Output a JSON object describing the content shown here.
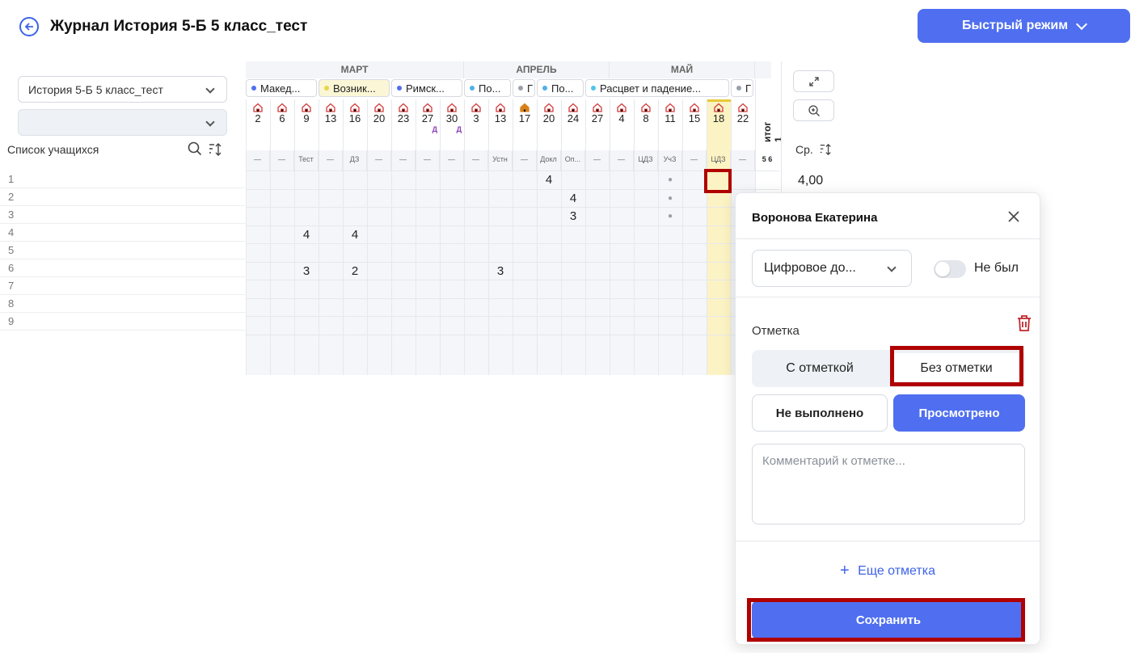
{
  "header": {
    "title": "Журнал История 5-Б 5 класс_тест",
    "mode_button": "Быстрый режим"
  },
  "left": {
    "group_select": "История 5-Б 5 класс_тест",
    "second_select": "",
    "students_label": "Список учащихся",
    "rows": [
      "1",
      "2",
      "3",
      "4",
      "5",
      "6",
      "7",
      "8",
      "9"
    ]
  },
  "grid": {
    "months": [
      "МАРТ",
      "АПРЕЛЬ",
      "МАЙ"
    ],
    "topics": [
      "Макед...",
      "Возник...",
      "Римск...",
      "По...",
      "Г",
      "По...",
      "Расцвет и падение...",
      "Г"
    ],
    "days": [
      "2",
      "6",
      "9",
      "13",
      "16",
      "20",
      "23",
      "27",
      "30",
      "3",
      "13",
      "17",
      "20",
      "24",
      "27",
      "4",
      "8",
      "11",
      "15",
      "18",
      "22"
    ],
    "day_marks": [
      "",
      "",
      "",
      "",
      "",
      "",
      "",
      "Д",
      "Д",
      "",
      "",
      "",
      "",
      "",
      "",
      "",
      "",
      "",
      "",
      "",
      ""
    ],
    "types": [
      "—",
      "—",
      "Тест",
      "—",
      "ДЗ",
      "—",
      "—",
      "—",
      "—",
      "—",
      "Устн",
      "—",
      "Докл",
      "Оп...",
      "—",
      "—",
      "ЦДЗ",
      "УчЗ",
      "—",
      "ЦДЗ",
      "—"
    ],
    "itog_label": "итог 1",
    "itog_value": "5 6",
    "values": {
      "r1c12": "4",
      "r2c13": "4",
      "r3c13": "3",
      "r4c2": "4",
      "r4c4": "4",
      "r6c2": "3",
      "r6c4": "2",
      "r6c10": "3"
    }
  },
  "avg": {
    "label": "Ср.",
    "value_row1": "4,00"
  },
  "popup": {
    "student_name": "Воронова Екатерина",
    "type_select": "Цифровое до...",
    "absent_label": "Не был",
    "mark_label": "Отметка",
    "with_mark": "С отметкой",
    "without_mark": "Без отметки",
    "not_done": "Не выполнено",
    "viewed": "Просмотрено",
    "comment_placeholder": "Комментарий к отметке...",
    "add_more": "Еще отметка",
    "save": "Сохранить"
  },
  "colors": {
    "accent": "#4f6ff0",
    "highlight_col": "#fcf3c4",
    "annotation_red": "#b00000"
  }
}
